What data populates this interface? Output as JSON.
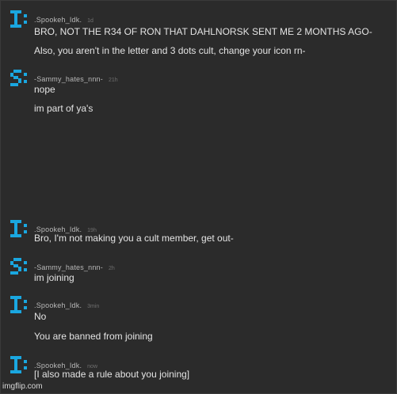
{
  "colors": {
    "background": "#2b2b2b",
    "avatar": "#1aa7e0",
    "username": "#b8b8b8",
    "timestamp": "#6f6f6f",
    "message_text": "#e4e4e4"
  },
  "messages": [
    {
      "user": ".Spookeh_Idk.",
      "time": "1d",
      "avatar_icon": "i-colon-icon",
      "lines": [
        "BRO, NOT THE R34 OF RON THAT DAHLNORSK SENT ME 2 MONTHS AGO-",
        "Also, you aren't in the letter and 3 dots cult, change your icon rn-"
      ]
    },
    {
      "user": "-Sammy_hates_nnn-",
      "time": "21h",
      "avatar_icon": "s-colon-icon",
      "lines": [
        "nope",
        "im part of ya's"
      ]
    },
    {
      "user": ".Spookeh_Idk.",
      "time": "19h",
      "avatar_icon": "i-colon-icon",
      "lines": [
        "Bro, I'm not making you a cult member, get out-"
      ]
    },
    {
      "user": "-Sammy_hates_nnn-",
      "time": "2h",
      "avatar_icon": "s-colon-icon",
      "lines": [
        "im joining"
      ]
    },
    {
      "user": ".Spookeh_Idk.",
      "time": "3min",
      "avatar_icon": "i-colon-icon",
      "lines": [
        "No",
        "You are banned from joining"
      ]
    },
    {
      "user": ".Spookeh_Idk.",
      "time": "now",
      "avatar_icon": "i-colon-icon",
      "lines": [
        "[I also made a rule about you joining]"
      ]
    }
  ],
  "watermark": "imgflip.com"
}
